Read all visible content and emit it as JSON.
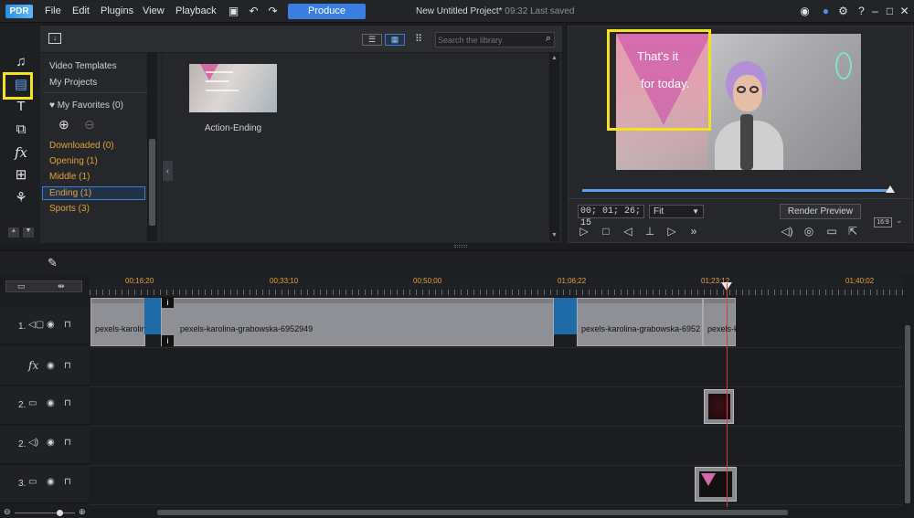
{
  "app": {
    "logo": "PDR"
  },
  "menu": [
    "File",
    "Edit",
    "Plugins",
    "View",
    "Playback"
  ],
  "produce_label": "Produce",
  "project_title": "New Untitled Project*",
  "saved_text": "09:32 Last saved",
  "library": {
    "search_placeholder": "Search the library",
    "side_items": [
      "Video Templates",
      "My Projects"
    ],
    "favorites": "My Favorites (0)",
    "categories": [
      "Downloaded  (0)",
      "Opening  (1)",
      "Middle  (1)",
      "Ending  (1)",
      "Sports  (3)"
    ],
    "selected_category": "Ending  (1)",
    "templates": [
      {
        "name": "Action-Ending"
      }
    ]
  },
  "preview": {
    "overlay_line1": "That's it",
    "overlay_line2": "for today.",
    "timecode": "00; 01; 26; 15",
    "fit": "Fit",
    "render_preview": "Render Preview",
    "aspect": "16:9",
    "progress": 0.99
  },
  "timeline": {
    "ruler": [
      "00;16;20",
      "00;33;10",
      "00;50;00",
      "01;06;22",
      "01;23;12",
      "01;40;02"
    ],
    "tracks": [
      {
        "label": "1.",
        "type": "video-audio"
      },
      {
        "label": "fx",
        "type": "effect"
      },
      {
        "label": "2.",
        "type": "video"
      },
      {
        "label": "2.",
        "type": "audio"
      },
      {
        "label": "3.",
        "type": "video"
      }
    ],
    "clips": [
      {
        "name": "pexels-karolin"
      },
      {
        "name": "pexels-karolina-grabowska-6952949"
      },
      {
        "name": "pexels-karolina-grabowska-6952"
      },
      {
        "name": "pexels-k"
      }
    ]
  },
  "colors": {
    "accent": "#3a7fe0",
    "highlight": "#f4e21b",
    "category": "#e2a23a",
    "playhead": "#e23a3a"
  }
}
